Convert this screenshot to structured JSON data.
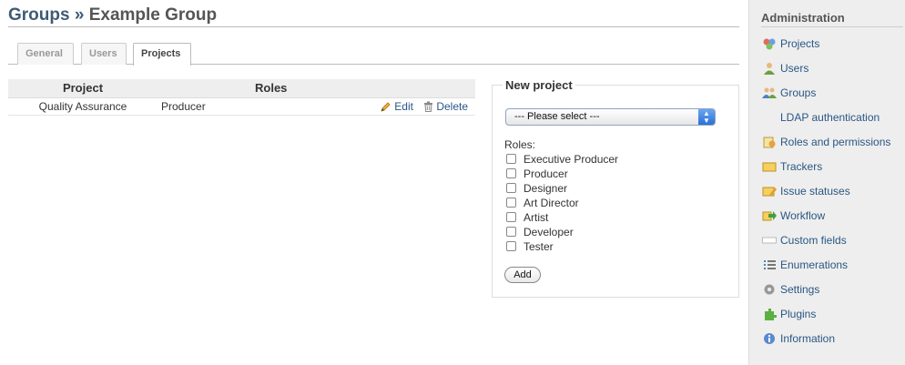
{
  "header": {
    "crumb": "Groups",
    "separator": "»",
    "title": "Example Group"
  },
  "tabs": [
    "General",
    "Users",
    "Projects"
  ],
  "memberships": {
    "columns": [
      "Project",
      "Roles"
    ],
    "rows": [
      {
        "project": "Quality Assurance",
        "roles": "Producer",
        "edit": "Edit",
        "delete": "Delete"
      }
    ]
  },
  "new_project": {
    "legend": "New project",
    "select_value": "--- Please select ---",
    "roles_label": "Roles:",
    "roles": [
      "Executive Producer",
      "Producer",
      "Designer",
      "Art Director",
      "Artist",
      "Developer",
      "Tester"
    ],
    "add_label": "Add"
  },
  "sidebar": {
    "title": "Administration",
    "items": [
      {
        "label": "Projects",
        "icon": "projects-icon"
      },
      {
        "label": "Users",
        "icon": "user-icon"
      },
      {
        "label": "Groups",
        "icon": "group-icon"
      },
      {
        "label": "LDAP authentication",
        "icon": ""
      },
      {
        "label": "Roles and permissions",
        "icon": "lock-icon"
      },
      {
        "label": "Trackers",
        "icon": "ticket-icon"
      },
      {
        "label": "Issue statuses",
        "icon": "ticket-edit-icon"
      },
      {
        "label": "Workflow",
        "icon": "arrow-icon"
      },
      {
        "label": "Custom fields",
        "icon": "textfield-icon"
      },
      {
        "label": "Enumerations",
        "icon": "list-icon"
      },
      {
        "label": "Settings",
        "icon": "gear-icon"
      },
      {
        "label": "Plugins",
        "icon": "plugin-icon"
      },
      {
        "label": "Information",
        "icon": "info-icon"
      }
    ]
  },
  "colors": {
    "link": "#2a5685",
    "title_link": "#3e5b76",
    "sidebar_bg": "#eeeeee"
  }
}
